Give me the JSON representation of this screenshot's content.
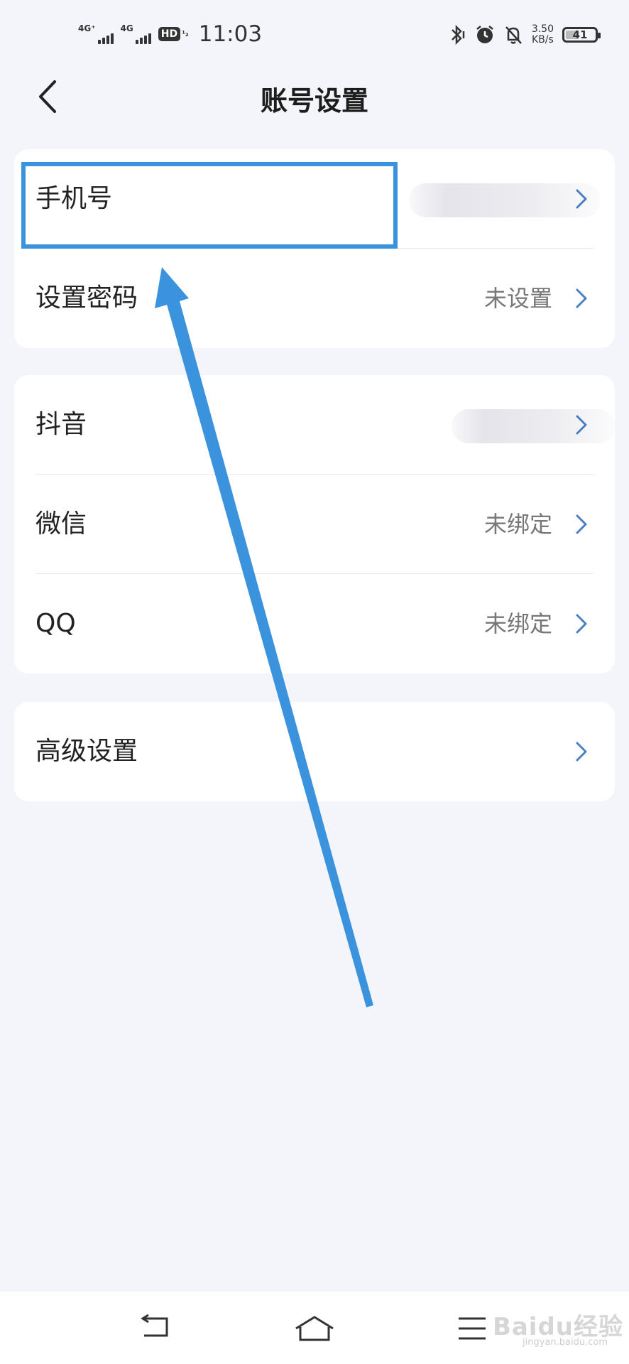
{
  "status": {
    "net1": "4G⁺",
    "net2": "4G",
    "hd": "HD",
    "hd_sub": "1\n2",
    "time": "11:03",
    "speed_value": "3.50",
    "speed_unit": "KB/s",
    "battery": "41"
  },
  "header": {
    "title": "账号设置"
  },
  "sections": {
    "account": {
      "phone": {
        "label": "手机号",
        "value": ""
      },
      "password": {
        "label": "设置密码",
        "value": "未设置"
      }
    },
    "bindings": {
      "douyin": {
        "label": "抖音",
        "value": ""
      },
      "wechat": {
        "label": "微信",
        "value": "未绑定"
      },
      "qq": {
        "label": "QQ",
        "value": "未绑定"
      }
    },
    "advanced": {
      "label": "高级设置"
    }
  },
  "watermark": {
    "text": "Baidu经验",
    "sub": "jingyan.baidu.com"
  },
  "colors": {
    "accent": "#3b93de",
    "chevron": "#4a7fc1",
    "background": "#f4f5fa"
  }
}
